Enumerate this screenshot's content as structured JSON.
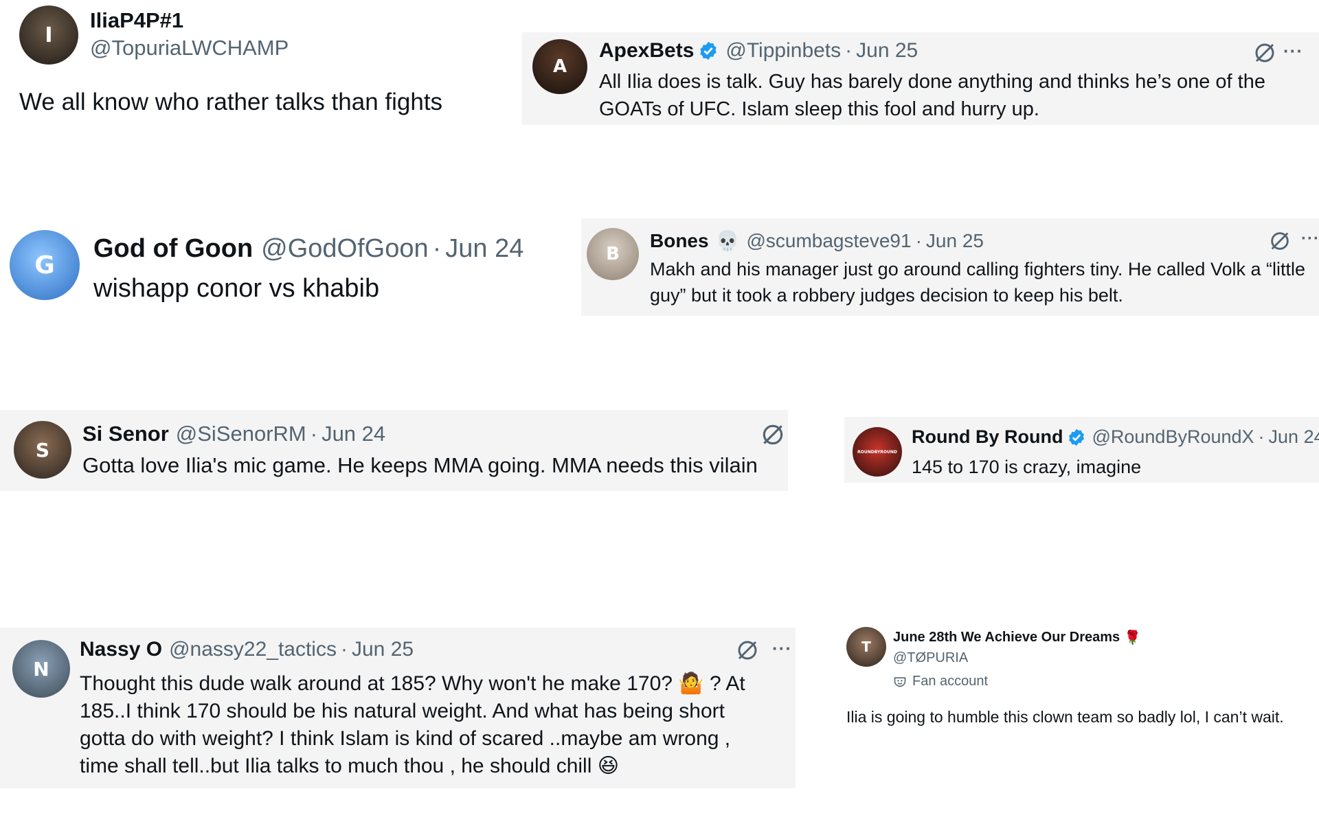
{
  "tweets": [
    {
      "name": "IliaP4P#1",
      "handle": "@TopuriaLWCHAMP",
      "text": "We all know who rather talks than fights"
    },
    {
      "name": "ApexBets",
      "handle": "@Tippinbets",
      "date": "Jun 25",
      "verified": true,
      "text": "All Ilia does is talk. Guy has barely done anything and thinks he’s one of the GOATs of UFC. Islam sleep this fool and hurry up."
    },
    {
      "name": "God of Goon",
      "handle": "@GodOfGoon",
      "date": "Jun 24",
      "text": "wishapp conor vs khabib"
    },
    {
      "name": "Bones",
      "name_emoji": "💀",
      "handle": "@scumbagsteve91",
      "date": "Jun 25",
      "text": "Makh and his manager just go around calling fighters tiny. He called Volk a “little guy” but it took a robbery judges decision to keep his belt."
    },
    {
      "name": "Si Senor",
      "handle": "@SiSenorRM",
      "date": "Jun 24",
      "text": "Gotta love Ilia's mic game. He keeps MMA going. MMA needs this vilain"
    },
    {
      "name": "Round By Round",
      "handle": "@RoundByRoundX",
      "date": "Jun 24",
      "verified": true,
      "text": "145 to 170 is crazy, imagine",
      "avatar_text": "ROUNDBYROUND"
    },
    {
      "name": "Nassy O",
      "handle": "@nassy22_tactics",
      "date": "Jun 25",
      "text": "Thought this dude walk around at 185? Why won't he make 170? 🤷 ? At 185..I think 170 should be his natural weight. And what has being short gotta do with weight?  I think Islam is kind of scared ..maybe am wrong , time shall tell..but Ilia talks to much thou , he should chill 😆"
    },
    {
      "name": "June 28th We Achieve Our Dreams",
      "name_emoji": "🌹",
      "handle": "@TØPURIA",
      "badge": "Fan account",
      "text": "Ilia is going to humble this clown team so badly lol, I can’t wait."
    }
  ],
  "separator": "·",
  "more_glyph": "···",
  "colors": {
    "verified": "#1d9bf0",
    "handle": "#536471",
    "card_bg": "#f4f4f5",
    "text": "#0f1419"
  },
  "icons": [
    "grok-icon",
    "more-icon",
    "verified-badge-icon",
    "fan-account-icon"
  ]
}
